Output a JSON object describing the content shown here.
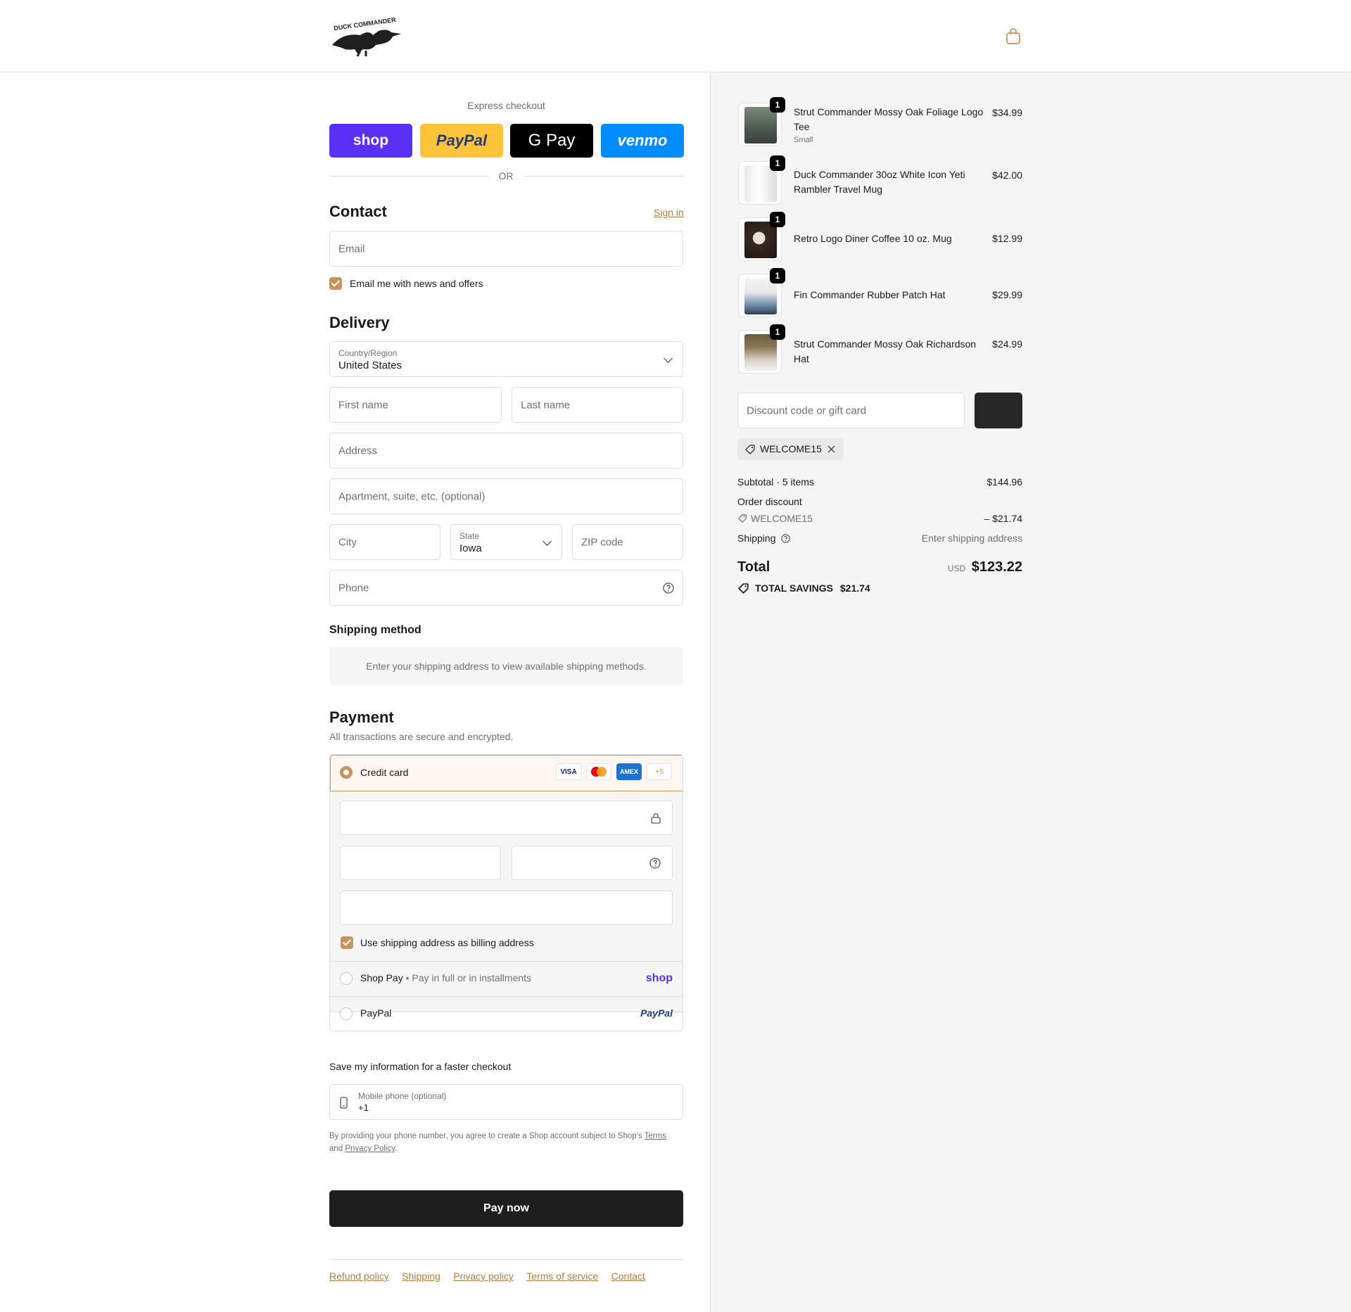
{
  "brand": {
    "name": "DUCK COMMANDER",
    "accent": "#c4955e"
  },
  "express": {
    "title": "Express checkout",
    "buttons": [
      {
        "label": "shop",
        "color": "#5a31f4"
      },
      {
        "label": "PayPal",
        "color": "#ffc439"
      },
      {
        "label": "G Pay",
        "color": "#000000"
      },
      {
        "label": "venmo",
        "color": "#008cff"
      }
    ],
    "or_label": "OR"
  },
  "contact": {
    "heading": "Contact",
    "sign_in": "Sign in",
    "email_placeholder": "Email",
    "news_label": "Email me with news and offers"
  },
  "delivery": {
    "heading": "Delivery",
    "country_label": "Country/Region",
    "country_value": "United States",
    "first_name": "First name",
    "last_name": "Last name",
    "address": "Address",
    "apartment": "Apartment, suite, etc. (optional)",
    "city": "City",
    "state_label": "State",
    "state_value": "Iowa",
    "zip": "ZIP code",
    "phone": "Phone"
  },
  "shipping_method": {
    "heading": "Shipping method",
    "note": "Enter your shipping address to view available shipping methods."
  },
  "payment": {
    "heading": "Payment",
    "subtitle": "All transactions are secure and encrypted.",
    "credit_card": "Credit card",
    "card_badges": [
      "VISA",
      "MC",
      "AMEX",
      "+5"
    ],
    "billing_label": "Use shipping address as billing address",
    "shop_pay": "Shop Pay",
    "shop_pay_sub": "Pay in full or in installments",
    "shop_pay_logo": "shop",
    "paypal": "PayPal",
    "paypal_logo": "PayPal"
  },
  "save_info": {
    "heading": "Save my information for a faster checkout",
    "mobile_label": "Mobile phone (optional)",
    "mobile_value": "+1",
    "legal_prefix": "By providing your phone number, you agree to create a Shop account subject to Shop's",
    "terms": "Terms",
    "and": "and",
    "privacy": "Privacy Policy",
    "period": "."
  },
  "pay_now": "Pay now",
  "footer_links": [
    "Refund policy",
    "Shipping",
    "Privacy policy",
    "Terms of service",
    "Contact"
  ],
  "cart": {
    "items": [
      {
        "name": "Strut Commander Mossy Oak Foliage Logo Tee",
        "variant": "Small",
        "price": "$34.99",
        "qty": "1"
      },
      {
        "name": "Duck Commander 30oz White Icon Yeti Rambler Travel Mug",
        "variant": "",
        "price": "$42.00",
        "qty": "1"
      },
      {
        "name": "Retro Logo Diner Coffee 10 oz. Mug",
        "variant": "",
        "price": "$12.99",
        "qty": "1"
      },
      {
        "name": "Fin Commander Rubber Patch Hat",
        "variant": "",
        "price": "$29.99",
        "qty": "1"
      },
      {
        "name": "Strut Commander Mossy Oak Richardson Hat",
        "variant": "",
        "price": "$24.99",
        "qty": "1"
      }
    ],
    "discount_placeholder": "Discount code or gift card",
    "applied_code": "WELCOME15",
    "subtotal_label": "Subtotal · 5 items",
    "subtotal_value": "$144.96",
    "order_discount_label": "Order discount",
    "discount_code": "WELCOME15",
    "discount_value": "– $21.74",
    "shipping_label": "Shipping",
    "shipping_value": "Enter shipping address",
    "total_label": "Total",
    "currency": "USD",
    "total_value": "$123.22",
    "savings_label": "TOTAL SAVINGS",
    "savings_value": "$21.74"
  }
}
